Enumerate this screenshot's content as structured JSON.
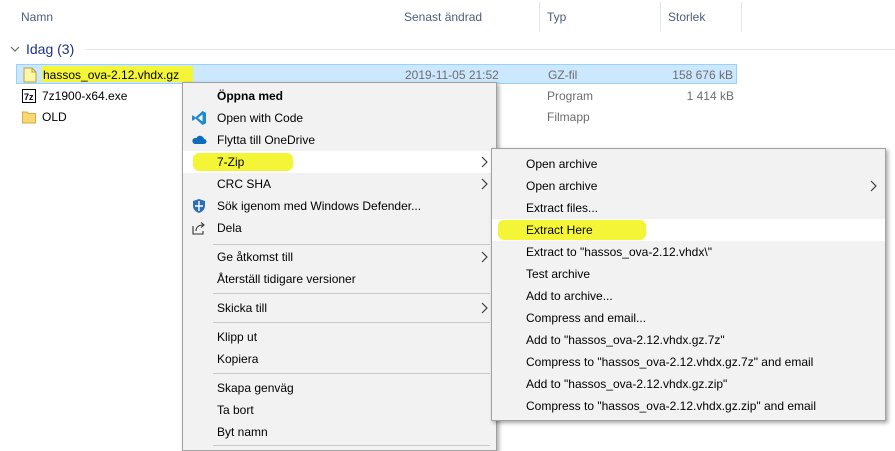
{
  "columns": [
    "Namn",
    "Senast ändrad",
    "Typ",
    "Storlek"
  ],
  "group": {
    "label": "Idag (3)"
  },
  "files": [
    {
      "name": "hassos_ova-2.12.vhdx.gz",
      "date": "2019-11-05 21:52",
      "type": "GZ-fil",
      "size": "158 676 kB",
      "icon": "gz-file-icon",
      "selected": true
    },
    {
      "name": "7z1900-x64.exe",
      "date": "",
      "type": "Program",
      "size": "1 414 kB",
      "icon": "7zip-exe-icon",
      "selected": false
    },
    {
      "name": "OLD",
      "date": "",
      "type": "Filmapp",
      "size": "",
      "icon": "folder-icon",
      "selected": false
    }
  ],
  "context_menu": {
    "items": [
      {
        "label": "Öppna med",
        "bold": true,
        "icon": "",
        "submenu": false
      },
      {
        "label": "Open with Code",
        "icon": "vscode-icon",
        "submenu": false
      },
      {
        "label": "Flytta till OneDrive",
        "icon": "onedrive-cloud-icon",
        "submenu": false
      },
      {
        "label": "7-Zip",
        "icon": "",
        "submenu": true,
        "hover": true
      },
      {
        "label": "CRC SHA",
        "icon": "",
        "submenu": true
      },
      {
        "label": "Sök igenom med Windows Defender...",
        "icon": "windows-defender-icon",
        "submenu": false
      },
      {
        "label": "Dela",
        "icon": "share-icon",
        "submenu": false
      },
      {
        "label": "Ge åtkomst till",
        "icon": "",
        "submenu": true
      },
      {
        "label": "Återställ tidigare versioner",
        "icon": "",
        "submenu": false
      },
      {
        "label": "Skicka till",
        "icon": "",
        "submenu": true
      },
      {
        "label": "Klipp ut",
        "icon": "",
        "submenu": false
      },
      {
        "label": "Kopiera",
        "icon": "",
        "submenu": false
      },
      {
        "label": "Skapa genväg",
        "icon": "",
        "submenu": false
      },
      {
        "label": "Ta bort",
        "icon": "",
        "submenu": false
      },
      {
        "label": "Byt namn",
        "icon": "",
        "submenu": false
      }
    ]
  },
  "sevenzip_menu": {
    "items": [
      {
        "label": "Open archive",
        "submenu": false
      },
      {
        "label": "Open archive",
        "submenu": true
      },
      {
        "label": "Extract files...",
        "submenu": false
      },
      {
        "label": "Extract Here",
        "submenu": false,
        "hover": true
      },
      {
        "label": "Extract to \"hassos_ova-2.12.vhdx\\\"",
        "submenu": false
      },
      {
        "label": "Test archive",
        "submenu": false
      },
      {
        "label": "Add to archive...",
        "submenu": false
      },
      {
        "label": "Compress and email...",
        "submenu": false
      },
      {
        "label": "Add to \"hassos_ova-2.12.vhdx.gz.7z\"",
        "submenu": false
      },
      {
        "label": "Compress to \"hassos_ova-2.12.vhdx.gz.7z\" and email",
        "submenu": false
      },
      {
        "label": "Add to \"hassos_ova-2.12.vhdx.gz.zip\"",
        "submenu": false
      },
      {
        "label": "Compress to \"hassos_ova-2.12.vhdx.gz.zip\" and email",
        "submenu": false
      }
    ]
  },
  "colors": {
    "highlight": "#f5f538",
    "selection": "#cce8ff",
    "menu_bg": "#f2f2f2",
    "group_label": "#1e3287"
  }
}
